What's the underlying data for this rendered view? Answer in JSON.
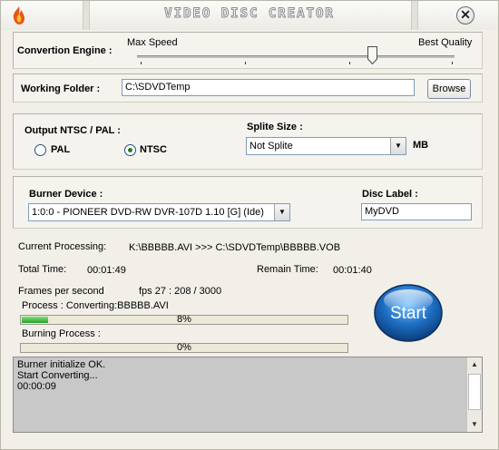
{
  "window": {
    "title": "VIDEO DISC CREATOR",
    "close_glyph": "✕"
  },
  "engine": {
    "label": "Convertion Engine :",
    "left_label": "Max Speed",
    "right_label": "Best Quality",
    "slider_value": 0.74
  },
  "working_folder": {
    "label": "Working Folder :",
    "value": "C:\\SDVDTemp",
    "browse_label": "Browse"
  },
  "output": {
    "label": "Output  NTSC / PAL :",
    "options": [
      {
        "label": "PAL",
        "selected": false
      },
      {
        "label": "NTSC",
        "selected": true
      }
    ]
  },
  "split": {
    "label": "Splite Size :",
    "value": "Not Splite",
    "unit": "MB"
  },
  "burner": {
    "label": "Burner Device :",
    "value": "1:0:0 - PIONEER DVD-RW  DVR-107D 1.10 [G] (Ide)"
  },
  "disc_label": {
    "label": "Disc Label :",
    "value": "MyDVD"
  },
  "status": {
    "current_label": "Current Processing:",
    "current_value": "K:\\BBBBB.AVI  >>>  C:\\SDVDTemp\\BBBBB.VOB",
    "total_label": "Total Time:",
    "total_value": "00:01:49",
    "remain_label": "Remain Time:",
    "remain_value": "00:01:40",
    "fps_label": "Frames per second",
    "fps_value": "fps  27  : 208 / 3000",
    "process_label": "Process : Converting:BBBBB.AVI",
    "process_percent": "8%",
    "process_fraction": 0.08,
    "burning_label": "Burning Process :",
    "burning_percent": "0%",
    "burning_fraction": 0
  },
  "start_label": "Start",
  "log": {
    "lines": [
      "Burner initialize OK.",
      "Start Converting...",
      "00:00:09"
    ]
  },
  "colors": {
    "accent": "#1e6fc4",
    "progress": "#2aa12a"
  }
}
